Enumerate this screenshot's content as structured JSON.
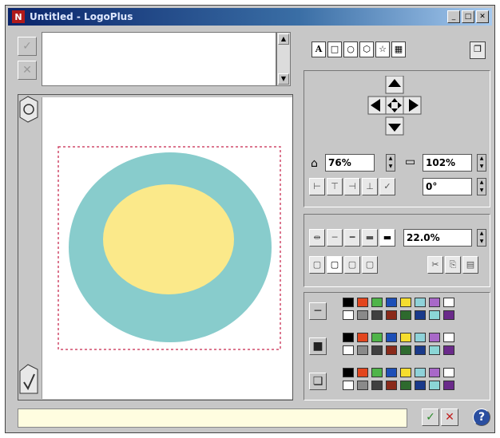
{
  "window": {
    "title": "Untitled - LogoPlus",
    "icon": "app-icon",
    "minimize": "_",
    "maximize": "□",
    "close": "✕"
  },
  "left_toolbar": {
    "accept_label": "✓",
    "cancel_label": "✕"
  },
  "canvas": {
    "outer_circle_color": "#88cccc",
    "inner_circle_color": "#fbe98a",
    "selection_color": "#d04a6a"
  },
  "shape_tools": [
    {
      "name": "text-tool",
      "label": "A"
    },
    {
      "name": "rectangle-tool",
      "label": "□"
    },
    {
      "name": "circle-tool",
      "label": "○"
    },
    {
      "name": "hexagon-tool",
      "label": "⬡"
    },
    {
      "name": "star-tool",
      "label": "☆"
    },
    {
      "name": "image-tool",
      "label": "▦"
    }
  ],
  "transform": {
    "width_scale": "76%",
    "height_scale": "102%",
    "rotation": "0°",
    "align_buttons": [
      "⊢",
      "⊤",
      "⊣",
      "⊥",
      "✓"
    ]
  },
  "line": {
    "width": "22.0%",
    "style_buttons": [
      "⇹",
      "─",
      "━",
      "▬",
      "▬"
    ],
    "corner_buttons": [
      "▢",
      "▢",
      "▢",
      "▢"
    ],
    "edit_buttons": [
      "✂",
      "⎘",
      "▤"
    ]
  },
  "palette": {
    "rows": [
      {
        "name": "line-color",
        "indicator": "─"
      },
      {
        "name": "fill-color",
        "indicator": "■"
      },
      {
        "name": "shadow-color",
        "indicator": "❏"
      }
    ],
    "colors_top": [
      "#000000",
      "#e3461e",
      "#4fb449",
      "#1d4fb7",
      "#f5dd2e",
      "#8fd2d9",
      "#a868c8",
      "#ffffff"
    ],
    "colors_bottom": [
      "#ffffff",
      "#8a8a8a",
      "#404040",
      "#8a2a1a",
      "#2e6a2e",
      "#1a3a8a",
      "#8bd6d6",
      "#6a2a8a"
    ]
  },
  "footer": {
    "status_text": "",
    "ok_label": "✓",
    "cancel_label": "✕",
    "help_label": "?"
  }
}
